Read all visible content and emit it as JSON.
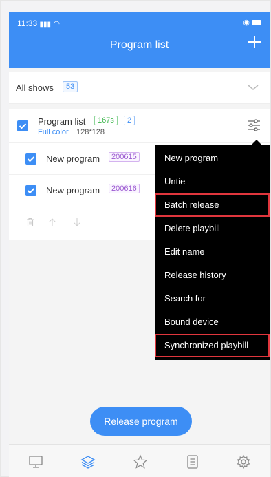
{
  "status": {
    "time": "11:33",
    "icons": "signal-wifi",
    "right_icons": "alarm-battery"
  },
  "header": {
    "title": "Program list",
    "add_icon": "plus-icon"
  },
  "shows": {
    "label": "All shows",
    "count": "53"
  },
  "group": {
    "title": "Program list",
    "duration": "167s",
    "count": "2",
    "color_mode": "Full color",
    "resolution": "128*128",
    "items": [
      {
        "label": "New program",
        "id": "200615"
      },
      {
        "label": "New program",
        "id": "200616"
      }
    ]
  },
  "menu": {
    "items": [
      {
        "label": "New program",
        "highlighted": false
      },
      {
        "label": "Untie",
        "highlighted": false
      },
      {
        "label": "Batch release",
        "highlighted": true
      },
      {
        "label": "Delete playbill",
        "highlighted": false
      },
      {
        "label": "Edit name",
        "highlighted": false
      },
      {
        "label": "Release history",
        "highlighted": false
      },
      {
        "label": "Search for",
        "highlighted": false
      },
      {
        "label": "Bound device",
        "highlighted": false
      },
      {
        "label": "Synchronized playbill",
        "highlighted": true
      }
    ]
  },
  "release_button": {
    "label": "Release program"
  },
  "colors": {
    "accent": "#3d8ef5",
    "highlight_border": "#e0363d",
    "menu_bg": "#000000"
  }
}
